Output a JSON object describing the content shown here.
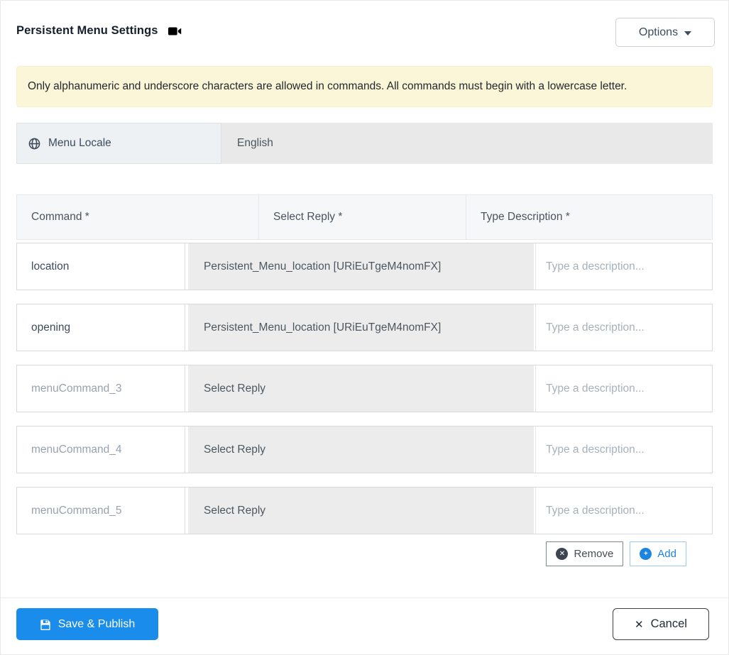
{
  "header": {
    "title": "Persistent Menu Settings",
    "title_icon": "video-camera-icon",
    "options_label": "Options"
  },
  "warning": {
    "text": "Only alphanumeric and underscore characters are allowed in commands. All commands must begin with a lowercase letter."
  },
  "locale": {
    "label": "Menu Locale",
    "icon": "globe-icon",
    "value": "English"
  },
  "table": {
    "headers": {
      "command": "Command *",
      "reply": "Select Reply *",
      "description": "Type Description *"
    },
    "rows": [
      {
        "command_value": "location",
        "command_placeholder": "",
        "reply": "Persistent_Menu_location [URiEuTgeM4nomFX]",
        "description_value": "",
        "description_placeholder": "Type a description..."
      },
      {
        "command_value": "opening",
        "command_placeholder": "",
        "reply": "Persistent_Menu_location [URiEuTgeM4nomFX]",
        "description_value": "",
        "description_placeholder": "Type a description..."
      },
      {
        "command_value": "",
        "command_placeholder": "menuCommand_3",
        "reply": "Select Reply",
        "description_value": "",
        "description_placeholder": "Type a description..."
      },
      {
        "command_value": "",
        "command_placeholder": "menuCommand_4",
        "reply": "Select Reply",
        "description_value": "",
        "description_placeholder": "Type a description..."
      },
      {
        "command_value": "",
        "command_placeholder": "menuCommand_5",
        "reply": "Select Reply",
        "description_value": "",
        "description_placeholder": "Type a description..."
      }
    ]
  },
  "actions": {
    "remove_label": "Remove",
    "remove_icon_glyph": "✕",
    "add_label": "Add",
    "add_icon_glyph": "+"
  },
  "footer": {
    "save_label": "Save & Publish",
    "cancel_label": "Cancel",
    "cancel_icon_glyph": "✕"
  },
  "colors": {
    "primary_blue": "#1a8ceb",
    "banner_bg": "#fcf6d9",
    "locale_label_bg": "#eef1f4",
    "disabled_gray_bg": "#e9e9e9",
    "reply_cell_bg": "#ececec",
    "header_row_bg": "#f5f7f9",
    "dark_text": "#3e4b5b",
    "placeholder_text": "#a7b1bb"
  }
}
